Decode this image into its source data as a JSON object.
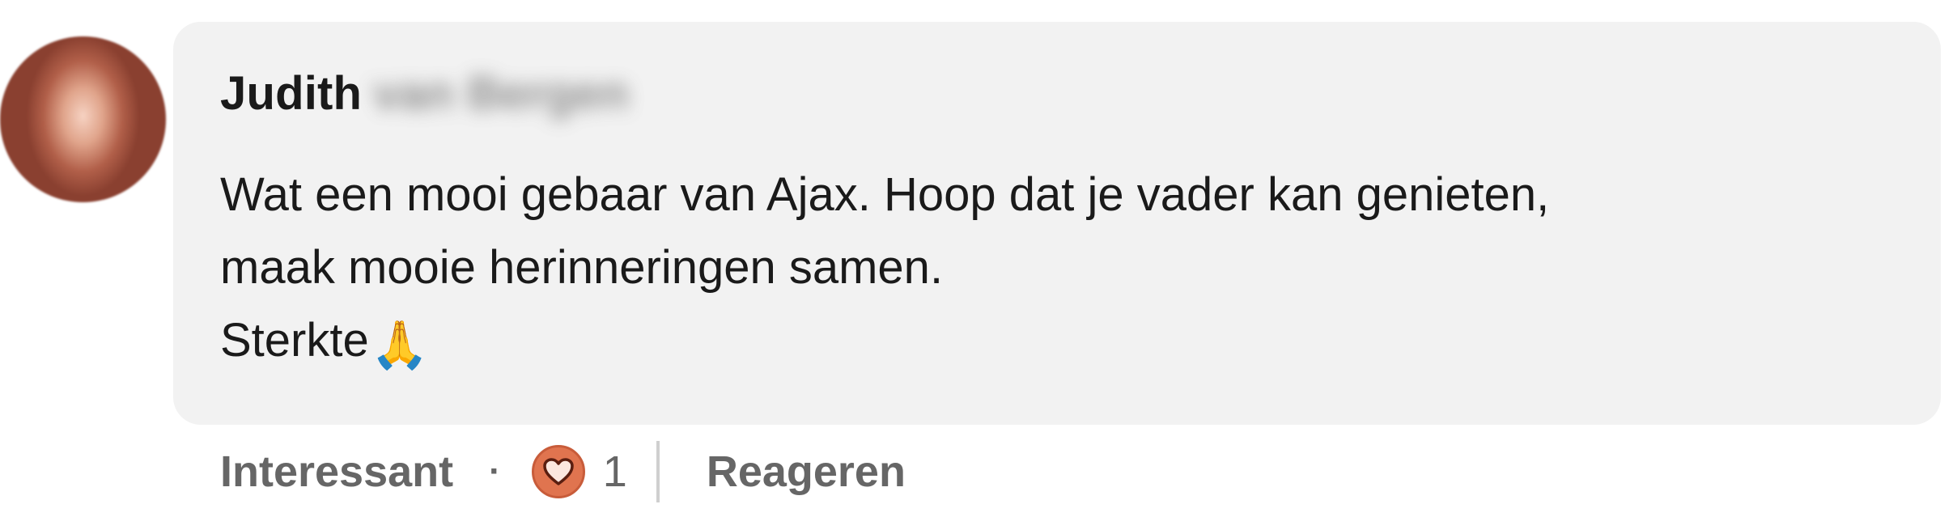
{
  "comment": {
    "author": {
      "first_name": "Judith",
      "last_name_obscured": "van Bergen"
    },
    "text_lines": [
      "Wat een mooi gebaar van Ajax. Hoop dat je vader kan genieten,",
      "maak mooie herinneringen samen.",
      "Sterkte"
    ],
    "emoji": "🙏",
    "emoji_name": "folded-hands",
    "actions": {
      "interesting_label": "Interessant",
      "separator": "·",
      "reaction_icon": "heart-icon",
      "reaction_count": "1",
      "reply_label": "Reageren"
    },
    "colors": {
      "bubble_background": "#f2f2f2",
      "reaction_background": "#e0744f",
      "action_text": "#666666"
    }
  }
}
